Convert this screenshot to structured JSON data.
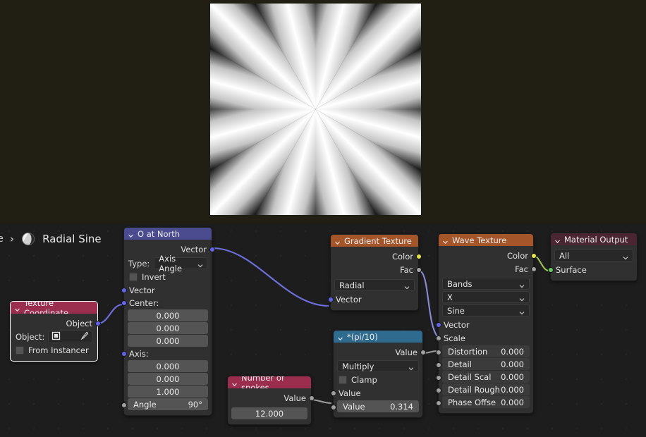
{
  "app": {
    "editor": "blender-shader-node-editor"
  },
  "preview": {
    "name": "radial-sine-texture-preview",
    "spokes": 12,
    "description": "Black and white radial sine starburst pattern"
  },
  "breadcrumb": {
    "truncated_item": "e",
    "separator": "›",
    "material_icon": "material-sphere-icon",
    "current": "Radial Sine"
  },
  "colors": {
    "header_vector": "#4b4b8f",
    "header_input": "#9b2d4f",
    "header_texture": "#a4562a",
    "header_converter": "#2f6b8f",
    "header_output": "#4a2632",
    "socket_vector": "#6363ea",
    "socket_value": "#a1a1a1",
    "socket_color": "#e5e54d",
    "socket_shader": "#63c763",
    "noodle_vector": "#6f6fe0",
    "noodle_value": "#9e9e9e",
    "editor_bg": "#1d1d1d",
    "node_bg": "#303030",
    "preview_bg": "#211f14"
  },
  "nodes": {
    "texture_coordinate": {
      "title": "Texture Coordinate",
      "selected": true,
      "outputs": [
        {
          "label": "Object",
          "socket": "vector"
        }
      ],
      "object_label": "Object:",
      "object_value": "",
      "object_icon": "object-data-icon",
      "eyedropper_icon": "eyedropper-icon",
      "from_instancer": {
        "label": "From Instancer",
        "checked": false
      }
    },
    "o_at_north": {
      "title": "O at North",
      "selected": false,
      "outputs": [
        {
          "label": "Vector",
          "socket": "vector"
        }
      ],
      "type_label": "Type:",
      "type_value": "Axis Angle",
      "invert": {
        "label": "Invert",
        "checked": false
      },
      "vector_input_label": "Vector",
      "center_label": "Center:",
      "center": [
        "0.000",
        "0.000",
        "0.000"
      ],
      "axis_label": "Axis:",
      "axis": [
        "0.000",
        "0.000",
        "1.000"
      ],
      "angle": {
        "label": "Angle",
        "value": "90°"
      }
    },
    "number_of_spokes": {
      "title": "Number of spokes",
      "selected": false,
      "outputs": [
        {
          "label": "Value",
          "socket": "value"
        }
      ],
      "value": "12.000"
    },
    "multiply_pi10": {
      "title": "*(pi/10)",
      "selected": false,
      "outputs": [
        {
          "label": "Value",
          "socket": "value"
        }
      ],
      "operation": "Multiply",
      "clamp": {
        "label": "Clamp",
        "checked": false
      },
      "input_a_label": "Value",
      "input_b": {
        "label": "Value",
        "value": "0.314"
      }
    },
    "gradient_texture": {
      "title": "Gradient Texture",
      "selected": false,
      "outputs": [
        {
          "label": "Color",
          "socket": "color"
        },
        {
          "label": "Fac",
          "socket": "value"
        }
      ],
      "gradient_type": "Radial",
      "vector_input_label": "Vector"
    },
    "wave_texture": {
      "title": "Wave Texture",
      "selected": false,
      "outputs": [
        {
          "label": "Color",
          "socket": "color"
        },
        {
          "label": "Fac",
          "socket": "value"
        }
      ],
      "wave_type": "Bands",
      "bands_direction": "X",
      "wave_profile": "Sine",
      "vector_input_label": "Vector",
      "scale_input_label": "Scale",
      "fields": [
        {
          "label": "Distortion",
          "value": "0.000"
        },
        {
          "label": "Detail",
          "value": "0.000"
        },
        {
          "label": "Detail Scal",
          "value": "0.000"
        },
        {
          "label": "Detail Rough",
          "value": "0.000"
        },
        {
          "label": "Phase Offse",
          "value": "0.000"
        }
      ]
    },
    "material_output": {
      "title": "Material Output",
      "selected": false,
      "target": "All",
      "inputs": [
        {
          "label": "Surface",
          "socket": "shader"
        }
      ]
    }
  }
}
